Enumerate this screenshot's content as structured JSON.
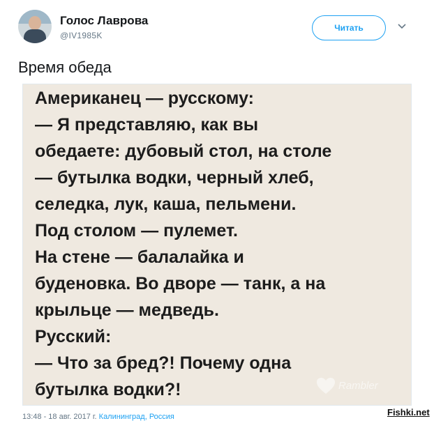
{
  "account": {
    "name": "Голос Лаврова",
    "handle": "@IV1985K"
  },
  "actions": {
    "follow_label": "Читать"
  },
  "tweet": {
    "text": "Время обеда"
  },
  "image": {
    "lines": [
      "Американец — русскому:",
      "— Я представляю, как вы",
      "обедаете: дубовый стол, на столе",
      "— бутылка водки, черный хлеб,",
      "селедка, лук, каша, пельмени.",
      "Под столом — пулемет.",
      "На стене — балалайка и",
      "буденовка. Во дворе — танк, а на",
      "крыльце — медведь.",
      "Русский:",
      "— Что за бред?! Почему одна",
      "бутылка водки?!"
    ],
    "watermark": "Rambler"
  },
  "footer": {
    "time_date": "13:48 - 18 авг. 2017 г.",
    "location": "Калининград, Россия"
  },
  "site_watermark": "Fishki.net",
  "colors": {
    "accent": "#1da1f2",
    "text": "#14171a",
    "muted": "#657786",
    "image_bg": "#efe9e0"
  }
}
